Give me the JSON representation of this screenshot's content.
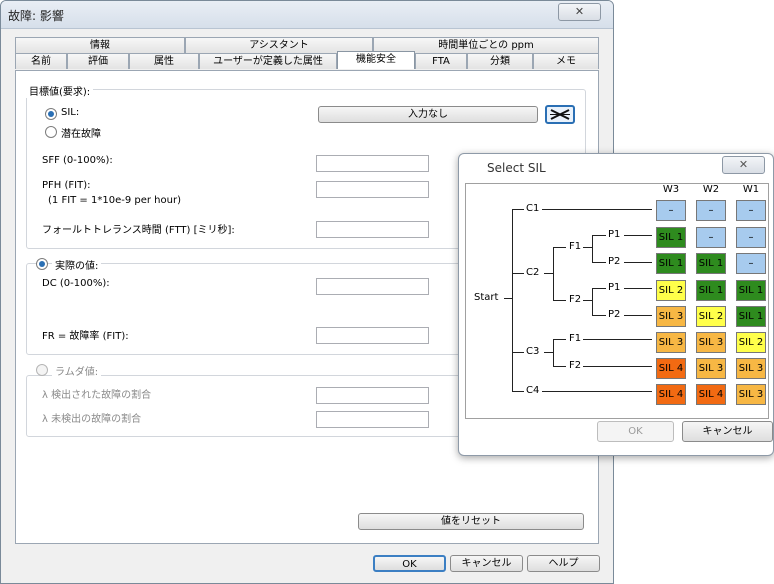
{
  "window": {
    "title": "故障: 影響",
    "close_glyph": "✕"
  },
  "tabs_row1": [
    "情報",
    "アシスタント",
    "時間単位ごとの ppm"
  ],
  "tabs_row2": [
    "名前",
    "評価",
    "属性",
    "ユーザーが定義した属性",
    "機能安全",
    "FTA",
    "分類",
    "メモ"
  ],
  "active_tab": "機能安全",
  "target": {
    "group_label": "目標値(要求):",
    "sil_label": "SIL:",
    "latent_label": "潜在故障",
    "input_button": "入力なし",
    "sff_label": "SFF (0-100%):",
    "pfh_label": "PFH (FIT):",
    "pfh_note": "(1  FIT = 1*10e-9 per hour)",
    "ftt_label": "フォールトトレランス時間 (FTT) [ミリ秒]:"
  },
  "actual": {
    "group_label": "実際の値:",
    "dc_label": "DC (0-100%):",
    "fr_label": "FR = 故障率 (FIT):"
  },
  "lambda": {
    "group_label": "ラムダ値:",
    "detected": "λ  検出された故障の割合",
    "undetected": "λ  未検出の故障の割合"
  },
  "buttons": {
    "reset": "値をリセット",
    "ok": "OK",
    "cancel": "キャンセル",
    "help": "ヘルプ"
  },
  "dialog": {
    "title": "Select SIL",
    "close_glyph": "✕",
    "ok": "OK",
    "cancel": "キャンセル",
    "columns": [
      "W3",
      "W2",
      "W1"
    ],
    "nodes": {
      "start": "Start",
      "c1": "C1",
      "c2": "C2",
      "c3": "C3",
      "c4": "C4",
      "f1": "F1",
      "f2": "F2",
      "p1": "P1",
      "p2": "P2"
    },
    "rows": [
      [
        "–",
        "–",
        "–"
      ],
      [
        "SIL 1",
        "–",
        "–"
      ],
      [
        "SIL 1",
        "SIL 1",
        "–"
      ],
      [
        "SIL 2",
        "SIL 1",
        "SIL 1"
      ],
      [
        "SIL 3",
        "SIL 2",
        "SIL 1"
      ],
      [
        "SIL 3",
        "SIL 3",
        "SIL 2"
      ],
      [
        "SIL 4",
        "SIL 3",
        "SIL 3"
      ],
      [
        "SIL 4",
        "SIL 4",
        "SIL 3"
      ]
    ],
    "colors": {
      "–": "#a7cbee",
      "SIL 1": "#2e8b1e",
      "SIL 2": "#ffff4a",
      "SIL 3": "#f7b744",
      "SIL 4": "#f26a12"
    }
  }
}
